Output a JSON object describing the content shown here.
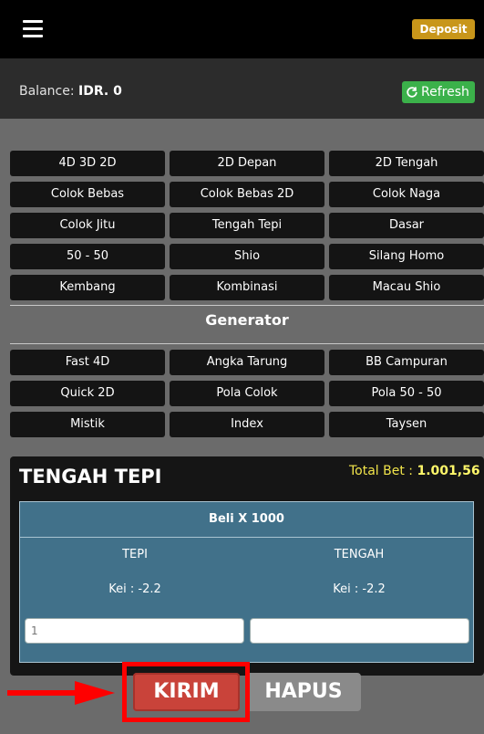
{
  "header": {
    "deposit_label": "Deposit"
  },
  "balance": {
    "label": "Balance:",
    "value": "IDR. 0",
    "refresh_label": "Refresh"
  },
  "games": {
    "row1": [
      "4D 3D 2D",
      "2D Depan",
      "2D Tengah"
    ],
    "row2": [
      "Colok Bebas",
      "Colok Bebas 2D",
      "Colok Naga"
    ],
    "row3": [
      "Colok Jitu",
      "Tengah Tepi",
      "Dasar"
    ],
    "row4": [
      "50 - 50",
      "Shio",
      "Silang Homo"
    ],
    "row5": [
      "Kembang",
      "Kombinasi",
      "Macau Shio"
    ]
  },
  "generator": {
    "title": "Generator",
    "row1": [
      "Fast 4D",
      "Angka Tarung",
      "BB Campuran"
    ],
    "row2": [
      "Quick 2D",
      "Pola Colok",
      "Pola 50 - 50"
    ],
    "row3": [
      "Mistik",
      "Index",
      "Taysen"
    ]
  },
  "bet_panel": {
    "title": "TENGAH TEPI",
    "total_label": "Total Bet : ",
    "total_value": "1.001,56",
    "header": "Beli X 1000",
    "col1_label": "TEPI",
    "col2_label": "TENGAH",
    "col1_kei": "Kei : -2.2",
    "col2_kei": "Kei : -2.2",
    "input1_placeholder": "1",
    "input2_placeholder": ""
  },
  "actions": {
    "submit_label": "KIRIM",
    "clear_label": "HAPUS"
  },
  "colors": {
    "deposit": "#c8961a",
    "refresh": "#3bb14a",
    "kirim": "#c9433a",
    "highlight": "#ff0000"
  }
}
